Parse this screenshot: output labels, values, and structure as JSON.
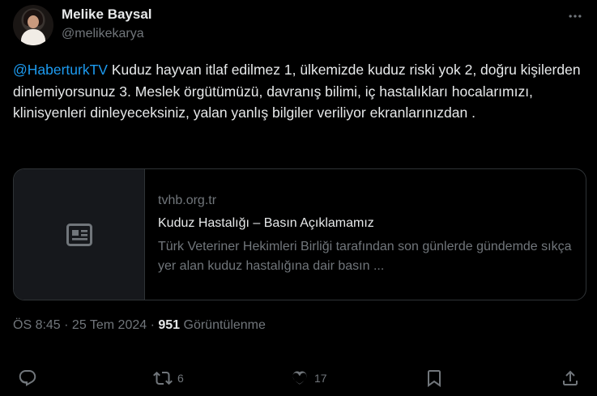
{
  "author": {
    "name": "Melike Baysal",
    "handle": "@melikekarya"
  },
  "tweet": {
    "mention": "@HaberturkTV",
    "text": " Kuduz hayvan itlaf edilmez 1, ülkemizde kuduz riski yok 2, doğru kişilerden dinlemiyorsunuz 3. Meslek örgütümüzü, davranış bilimi, iç hastalıkları hocalarımızı, klinisyenleri dinleyeceksiniz, yalan yanlış bilgiler veriliyor ekranlarınızdan ."
  },
  "link_card": {
    "domain": "tvhb.org.tr",
    "title": "Kuduz Hastalığı – Basın Açıklamamız",
    "description": "Türk Veteriner Hekimleri Birliği tarafından son günlerde gündemde sıkça yer alan kuduz hastalığına dair basın ..."
  },
  "meta": {
    "time": "ÖS 8:45 · 25 Tem 2024",
    "separator": " · ",
    "views_count": "951",
    "views_label": " Görüntülenme"
  },
  "actions": {
    "reply_count": "",
    "retweet_count": "6",
    "like_count": "17"
  },
  "icons": {
    "more": "more-horizontal-icon",
    "reply": "reply-icon",
    "retweet": "retweet-icon",
    "like": "heart-icon",
    "bookmark": "bookmark-icon",
    "share": "share-icon",
    "article": "article-icon"
  },
  "colors": {
    "background": "#000000",
    "text": "#e7e9ea",
    "secondary": "#71767b",
    "link": "#1d9bf0",
    "border": "#2f3336"
  }
}
